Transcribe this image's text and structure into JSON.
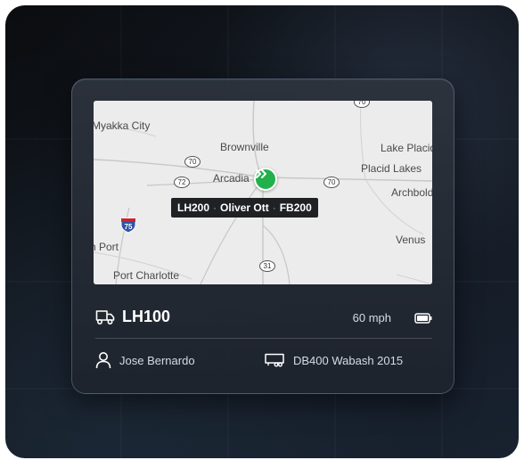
{
  "map": {
    "towns": [
      "Myakka City",
      "Brownville",
      "Arcadia",
      "Lake Placid",
      "Placid Lakes",
      "Archbold",
      "Venus",
      "Port Charlotte",
      "h Port"
    ],
    "routes": [
      "70",
      "72",
      "70",
      "31",
      "70",
      "75"
    ],
    "marker_icon": "double-chevron-right-icon",
    "label": {
      "unit_a": "LH200",
      "separator": "·",
      "driver": "Oliver Ott",
      "unit_b": "FB200"
    }
  },
  "vehicle": {
    "id": "LH100",
    "speed": "60 mph",
    "driver": "Jose Bernardo",
    "trailer": "DB400 Wabash 2015"
  },
  "colors": {
    "marker": "#22b04a",
    "card_border": "#96aac8"
  }
}
